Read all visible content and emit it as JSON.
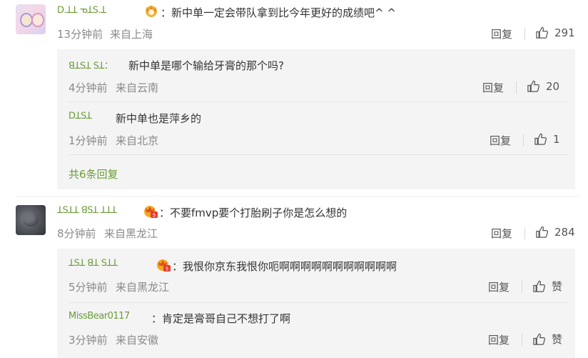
{
  "comments": [
    {
      "username": "ꓓ.ꓕꓕ ᓀꓕꓢ.ꓕ",
      "text": "：新中单一定会带队拿到比今年更好的成绩吧^ ^",
      "time": "13分钟前",
      "location": "来自上海",
      "reply_label": "回复",
      "likes": "291",
      "replies": [
        {
          "username": "ꓭꓕꓢꓕ ꓢꓕ：",
          "text": "新中单是哪个输给牙膏的那个吗?",
          "time": "4分钟前",
          "location": "来自云南",
          "reply_label": "回复",
          "likes": "20"
        },
        {
          "username": "ꓓꓕꓢꓕ",
          "text": "新中单也是萍乡的",
          "time": "1分钟前",
          "location": "来自北京",
          "reply_label": "回复",
          "likes": "1"
        }
      ],
      "total_replies": "共6条回复"
    },
    {
      "username": "ꓕꓢꓕꓕ ꓭꓢꓕ ꓕꓕꓕ",
      "text": "：不要fmvp要个打胎刷子你是怎么想的",
      "time": "8分钟前",
      "location": "来自黑龙江",
      "reply_label": "回复",
      "likes": "284",
      "replies": [
        {
          "username": "ꓕꓢꓕ ꓭꓕ ꓢꓕꓕ",
          "text": "：我恨你京东我恨你呃啊啊啊啊啊啊啊啊啊啊啊",
          "time": "5分钟前",
          "location": "来自黑龙江",
          "reply_label": "回复",
          "likes": "赞"
        },
        {
          "username": "MissBear0117",
          "text": "：肯定是膏哥自己不想打了啊",
          "time": "3分钟前",
          "location": "来自安徽",
          "reply_label": "回复",
          "likes": "赞"
        }
      ]
    }
  ],
  "colors": {
    "name": "#6a9c39",
    "text": "#333333",
    "meta": "#8a8a8a",
    "reply_bg": "#f4f4f4"
  }
}
